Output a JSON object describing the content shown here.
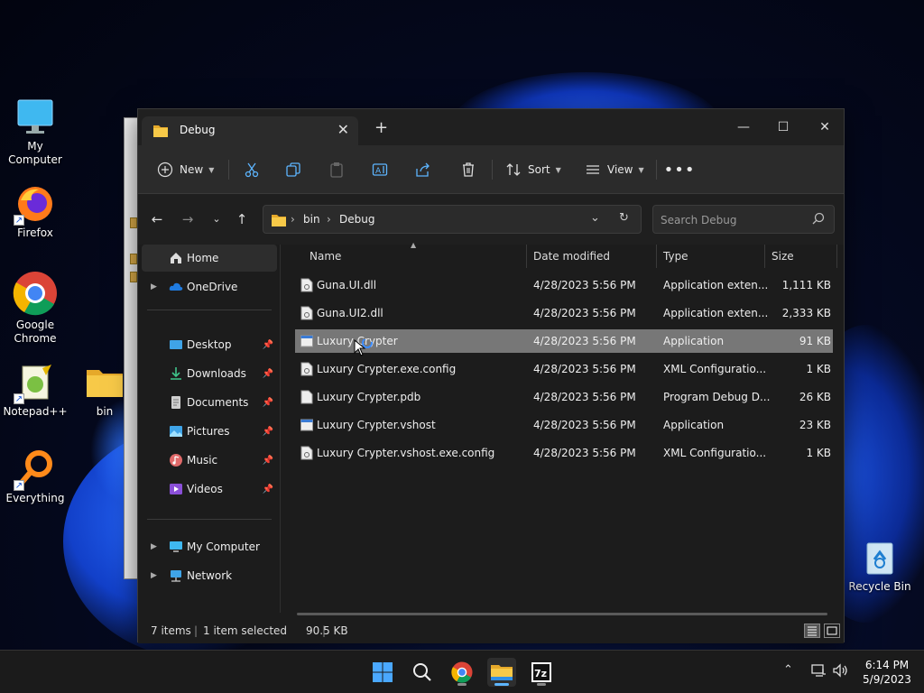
{
  "desktop": {
    "icons": [
      {
        "label": "My Computer"
      },
      {
        "label": "Firefox"
      },
      {
        "label": "Google Chrome"
      },
      {
        "label": "Notepad++"
      },
      {
        "label": "bin"
      },
      {
        "label": "Everything"
      },
      {
        "label": "Recycle Bin"
      }
    ]
  },
  "window": {
    "tab_title": "Debug",
    "commands": {
      "new": "New",
      "sort": "Sort",
      "view": "View"
    },
    "address": {
      "crumbs": [
        "bin",
        "Debug"
      ]
    },
    "search_placeholder": "Search Debug",
    "sidebar": {
      "items": [
        {
          "label": "Home"
        },
        {
          "label": "OneDrive"
        },
        {
          "label": "Desktop"
        },
        {
          "label": "Downloads"
        },
        {
          "label": "Documents"
        },
        {
          "label": "Pictures"
        },
        {
          "label": "Music"
        },
        {
          "label": "Videos"
        },
        {
          "label": "My Computer"
        },
        {
          "label": "Network"
        }
      ]
    },
    "columns": [
      "Name",
      "Date modified",
      "Type",
      "Size"
    ],
    "files": [
      {
        "name": "Guna.UI.dll",
        "date": "4/28/2023 5:56 PM",
        "type": "Application exten...",
        "size": "1,111 KB"
      },
      {
        "name": "Guna.UI2.dll",
        "date": "4/28/2023 5:56 PM",
        "type": "Application exten...",
        "size": "2,333 KB"
      },
      {
        "name": "Luxury Crypter",
        "date": "4/28/2023 5:56 PM",
        "type": "Application",
        "size": "91 KB"
      },
      {
        "name": "Luxury Crypter.exe.config",
        "date": "4/28/2023 5:56 PM",
        "type": "XML Configuratio...",
        "size": "1 KB"
      },
      {
        "name": "Luxury Crypter.pdb",
        "date": "4/28/2023 5:56 PM",
        "type": "Program Debug D...",
        "size": "26 KB"
      },
      {
        "name": "Luxury Crypter.vshost",
        "date": "4/28/2023 5:56 PM",
        "type": "Application",
        "size": "23 KB"
      },
      {
        "name": "Luxury Crypter.vshost.exe.config",
        "date": "4/28/2023 5:56 PM",
        "type": "XML Configuratio...",
        "size": "1 KB"
      }
    ],
    "status": {
      "count": "7 items",
      "selected": "1 item selected",
      "size": "90.5 KB"
    }
  },
  "taskbar": {
    "time": "6:14 PM",
    "date": "5/9/2023"
  },
  "colors": {
    "accent": "#5db5ff",
    "selection": "#777777",
    "folder": "#f4c542"
  }
}
